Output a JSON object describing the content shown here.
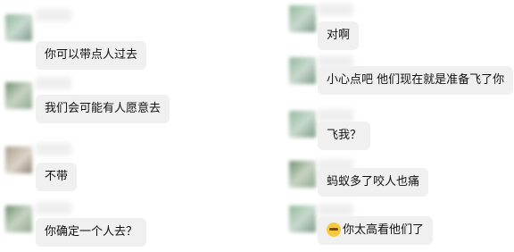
{
  "chat": {
    "left": [
      {
        "text": "你可以带点人过去"
      },
      {
        "text": "我们会可能有人愿意去"
      },
      {
        "text": "不带"
      },
      {
        "text": "你确定一个人去？"
      }
    ],
    "right": [
      {
        "text": "对啊"
      },
      {
        "text": "小心点吧 他们现在就是准备飞了你"
      },
      {
        "text": "飞我？"
      },
      {
        "text": "蚂蚁多了咬人也痛"
      },
      {
        "text": "你太高看他们了",
        "icon": "laughing-emoji-icon"
      }
    ]
  }
}
